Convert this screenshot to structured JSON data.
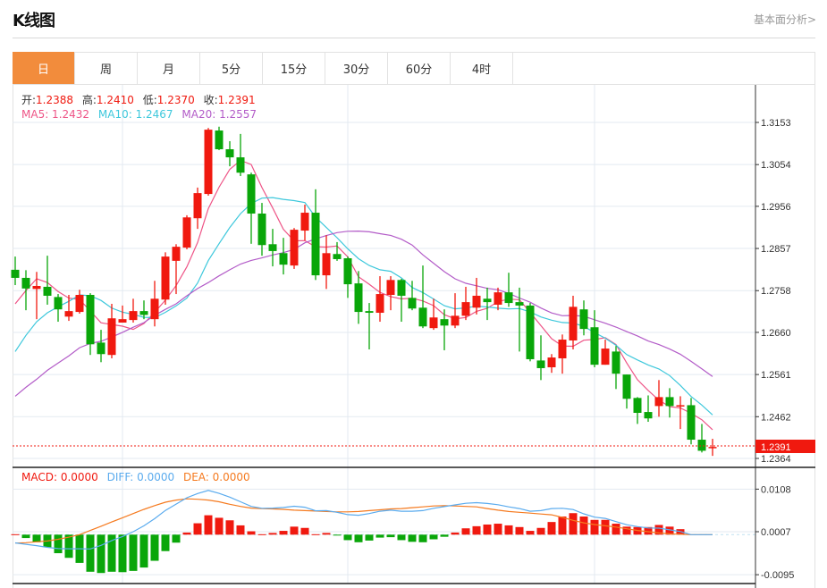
{
  "header": {
    "title": "K线图",
    "link": "基本面分析>"
  },
  "tabs": [
    {
      "label": "日",
      "active": true
    },
    {
      "label": "周"
    },
    {
      "label": "月"
    },
    {
      "label": "5分"
    },
    {
      "label": "15分"
    },
    {
      "label": "30分"
    },
    {
      "label": "60分"
    },
    {
      "label": "4时"
    }
  ],
  "ohlc_legend": {
    "open_label": "开:",
    "open": "1.2388",
    "high_label": "高:",
    "high": "1.2410",
    "low_label": "低:",
    "low": "1.2370",
    "close_label": "收:",
    "close": "1.2391"
  },
  "ma_legend": {
    "ma5": "MA5: 1.2432",
    "ma10": "MA10: 1.2467",
    "ma20": "MA20: 1.2557"
  },
  "macd_legend": {
    "macd": "MACD: 0.0000",
    "diff": "DIFF: 0.0000",
    "dea": "DEA: 0.0000"
  },
  "colors": {
    "up": "#F0190F",
    "down": "#09A609",
    "ma5": "#EE5587",
    "ma10": "#3EC8DC",
    "ma20": "#B35CC8",
    "diff": "#5AABEE",
    "dea": "#F57A1F",
    "active_tab": "#F28C3C"
  },
  "chart_data": [
    {
      "type": "candlestick",
      "price_ticks": [
        "1.3153",
        "1.3054",
        "1.2956",
        "1.2857",
        "1.2758",
        "1.2660",
        "1.2561",
        "1.2462",
        "1.2364"
      ],
      "ylim": [
        1.2364,
        1.3153
      ],
      "last_price": "1.2391",
      "open": [
        1.2807,
        1.2788,
        1.2762,
        1.2767,
        1.2743,
        1.2697,
        1.2708,
        1.2748,
        1.2636,
        1.2607,
        1.2683,
        1.2689,
        1.271,
        1.2691,
        1.2737,
        1.2828,
        1.2859,
        1.2928,
        1.2985,
        1.3134,
        1.309,
        1.3071,
        1.3031,
        1.2939,
        1.2867,
        1.2846,
        1.2817,
        1.2899,
        1.2941,
        1.2794,
        1.2844,
        1.2834,
        1.2775,
        1.271,
        1.2706,
        1.2748,
        1.2783,
        1.2741,
        1.2718,
        1.267,
        1.2691,
        1.2676,
        1.2699,
        1.2718,
        1.2739,
        1.2725,
        1.2754,
        1.2731,
        1.2723,
        1.2594,
        1.2578,
        1.2599,
        1.2641,
        1.2714,
        1.2672,
        1.2584,
        1.2615,
        1.2561,
        1.2506,
        1.2473,
        1.2487,
        1.2508,
        1.2487,
        1.2489,
        1.2408,
        1.2388
      ],
      "high": [
        1.2838,
        1.2806,
        1.2802,
        1.284,
        1.275,
        1.2748,
        1.276,
        1.2752,
        1.2666,
        1.2727,
        1.2723,
        1.2739,
        1.2735,
        1.2781,
        1.2848,
        1.2867,
        1.2935,
        1.3,
        1.314,
        1.3143,
        1.3109,
        1.3126,
        1.3035,
        1.2964,
        1.2903,
        1.2882,
        1.2905,
        1.296,
        1.2996,
        1.2888,
        1.2872,
        1.2838,
        1.2804,
        1.2729,
        1.2792,
        1.2792,
        1.2786,
        1.2781,
        1.2817,
        1.2739,
        1.2714,
        1.2752,
        1.2767,
        1.2788,
        1.2765,
        1.2765,
        1.28,
        1.2765,
        1.2729,
        1.2653,
        1.2609,
        1.2655,
        1.2746,
        1.2735,
        1.2712,
        1.2643,
        1.2628,
        1.2561,
        1.2508,
        1.2512,
        1.2548,
        1.2529,
        1.251,
        1.2506,
        1.2445,
        1.241
      ],
      "low": [
        1.2771,
        1.2712,
        1.2691,
        1.2725,
        1.2685,
        1.2687,
        1.2704,
        1.2607,
        1.259,
        1.2599,
        1.2683,
        1.2683,
        1.2691,
        1.2674,
        1.2725,
        1.275,
        1.2855,
        1.2903,
        1.2981,
        1.3088,
        1.305,
        1.3027,
        1.2868,
        1.284,
        1.2815,
        1.2796,
        1.2809,
        1.2876,
        1.2783,
        1.2762,
        1.2828,
        1.2741,
        1.268,
        1.262,
        1.2685,
        1.2712,
        1.2685,
        1.2712,
        1.267,
        1.2666,
        1.2618,
        1.267,
        1.2689,
        1.2702,
        1.2689,
        1.2712,
        1.272,
        1.2615,
        1.2592,
        1.2548,
        1.2565,
        1.2563,
        1.262,
        1.2653,
        1.2578,
        1.2584,
        1.2527,
        1.2481,
        1.2445,
        1.245,
        1.2462,
        1.246,
        1.2433,
        1.2397,
        1.2378,
        1.237
      ],
      "close": [
        1.2788,
        1.2763,
        1.2769,
        1.2746,
        1.2714,
        1.271,
        1.2748,
        1.2632,
        1.2609,
        1.2693,
        1.2691,
        1.271,
        1.2701,
        1.2739,
        1.2838,
        1.2861,
        1.293,
        1.2987,
        1.3136,
        1.309,
        1.3071,
        1.3035,
        1.2939,
        1.2865,
        1.2851,
        1.2819,
        1.2901,
        1.2941,
        1.2794,
        1.2846,
        1.2832,
        1.2773,
        1.2708,
        1.2706,
        1.275,
        1.2783,
        1.2746,
        1.2716,
        1.2674,
        1.2695,
        1.2676,
        1.2699,
        1.2731,
        1.2746,
        1.2731,
        1.2754,
        1.2729,
        1.2723,
        1.2597,
        1.2576,
        1.2601,
        1.2643,
        1.272,
        1.2668,
        1.2584,
        1.2622,
        1.2563,
        1.2504,
        1.2471,
        1.2458,
        1.2508,
        1.2487,
        1.2489,
        1.2408,
        1.2382,
        1.2391
      ],
      "ma5_leading": [
        1.2727,
        1.2758,
        1.2786,
        1.2777
      ],
      "ma10_leading": [
        1.2615,
        1.2653,
        1.2685,
        1.2706,
        1.272,
        1.2733,
        1.2748,
        1.2746,
        1.2735
      ],
      "ma20_leading": [
        1.251,
        1.2531,
        1.255,
        1.2571,
        1.2588,
        1.2605,
        1.2624,
        1.2634,
        1.2639,
        1.2649,
        1.266,
        1.2672,
        1.2683,
        1.27,
        1.2714,
        1.2727,
        1.2746,
        1.2763,
        1.2777
      ]
    },
    {
      "type": "macd",
      "ticks": [
        "0.0108",
        "0.0007",
        "-0.0095"
      ],
      "histogram": [
        0.0001,
        -0.0008,
        -0.0018,
        -0.003,
        -0.0044,
        -0.0055,
        -0.0067,
        -0.0088,
        -0.0091,
        -0.0088,
        -0.0089,
        -0.0086,
        -0.0078,
        -0.0062,
        -0.0039,
        -0.0019,
        0.0005,
        0.0027,
        0.0046,
        0.004,
        0.0034,
        0.0022,
        0.0008,
        0.0001,
        0.0004,
        0.0009,
        0.0019,
        0.0016,
        0.0001,
        0.0004,
        -0.0002,
        -0.0013,
        -0.0018,
        -0.0014,
        -0.0007,
        -0.0006,
        -0.0013,
        -0.0017,
        -0.0018,
        -0.0011,
        -0.0005,
        0.0005,
        0.0015,
        0.002,
        0.0024,
        0.0026,
        0.0022,
        0.0018,
        0.0009,
        0.0016,
        0.003,
        0.0043,
        0.0051,
        0.0043,
        0.0035,
        0.0035,
        0.0026,
        0.0019,
        0.0018,
        0.0018,
        0.0023,
        0.0019,
        0.0013,
        0,
        0,
        0
      ],
      "dea": [
        -0.002,
        -0.0019,
        -0.0017,
        -0.0015,
        -0.0011,
        -0.0006,
        0.0,
        0.001,
        0.002,
        0.003,
        0.004,
        0.005,
        0.006,
        0.0069,
        0.0077,
        0.0082,
        0.0085,
        0.0084,
        0.0082,
        0.0078,
        0.0072,
        0.0067,
        0.0063,
        0.0062,
        0.0061,
        0.006,
        0.0058,
        0.0057,
        0.0056,
        0.0055,
        0.0054,
        0.0054,
        0.0055,
        0.0057,
        0.0059,
        0.0061,
        0.0062,
        0.0064,
        0.0066,
        0.0068,
        0.0069,
        0.0068,
        0.0067,
        0.0066,
        0.0062,
        0.0058,
        0.0055,
        0.0053,
        0.0051,
        0.0049,
        0.0047,
        0.0041,
        0.0034,
        0.0028,
        0.0024,
        0.0021,
        0.0018,
        0.0014,
        0.001,
        0.0007,
        0.0004,
        0.0002,
        0.0001,
        0,
        0,
        0
      ]
    }
  ]
}
